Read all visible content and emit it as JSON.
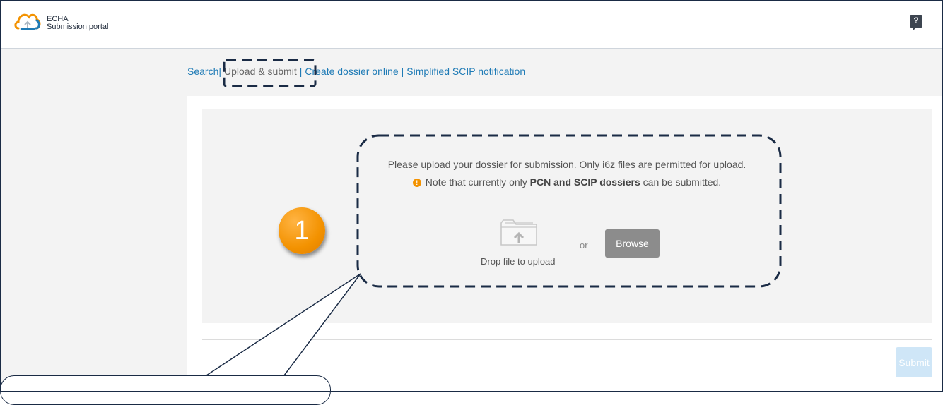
{
  "header": {
    "logo_line1": "ECHA",
    "logo_line2": "Submission portal",
    "help_glyph": "?"
  },
  "nav": {
    "links": [
      "Search",
      "Upload & submit",
      "Create dossier online",
      "Simplified SCIP notification"
    ],
    "separator": "|",
    "active_index": 1
  },
  "upload": {
    "message": "Please upload your dossier for submission. Only i6z files are permitted for upload.",
    "note_prefix": "Note that currently only ",
    "note_bold": "PCN and SCIP dossiers",
    "note_suffix": " can be submitted.",
    "drop_label": "Drop file to upload",
    "or_label": "or",
    "browse_label": "Browse",
    "icons": [
      "folder-upload-icon",
      "warning-icon"
    ]
  },
  "footer": {
    "submit_label": "Submit"
  },
  "annotation": {
    "step_number": "1"
  },
  "colors": {
    "link": "#1f7bb6",
    "accent_orange": "#f39200",
    "browse_bg": "#8c8c8c",
    "submit_bg": "#cfe6f7",
    "annotation_line": "#1a2b45"
  }
}
